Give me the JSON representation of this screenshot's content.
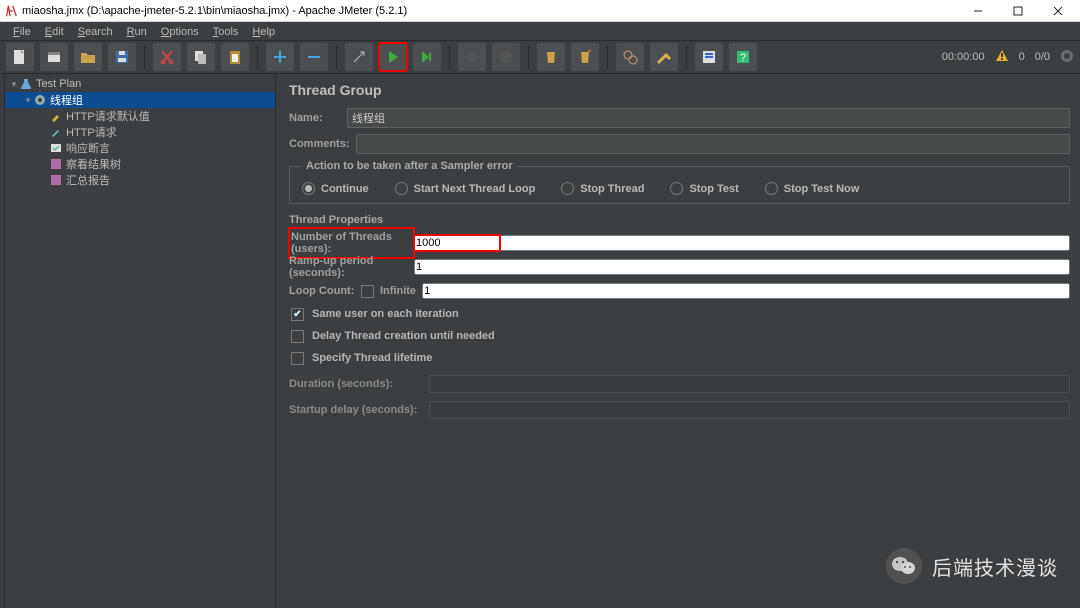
{
  "window": {
    "title": "miaosha.jmx (D:\\apache-jmeter-5.2.1\\bin\\miaosha.jmx) - Apache JMeter (5.2.1)"
  },
  "menu": {
    "file": "File",
    "edit": "Edit",
    "search": "Search",
    "run": "Run",
    "options": "Options",
    "tools": "Tools",
    "help": "Help"
  },
  "status": {
    "time": "00:00:00",
    "warn_count": "0",
    "active": "0/0"
  },
  "tree": {
    "test_plan": "Test Plan",
    "thread_group": "线程组",
    "http_defaults": "HTTP请求默认值",
    "http_request": "HTTP请求",
    "response_assert": "响应断言",
    "view_results": "察看结果树",
    "summary": "汇总报告"
  },
  "panel": {
    "title": "Thread Group",
    "labels": {
      "name": "Name:",
      "comments": "Comments:",
      "sampler_error_legend": "Action to be taken after a Sampler error",
      "continue": "Continue",
      "start_next": "Start Next Thread Loop",
      "stop_thread": "Stop Thread",
      "stop_test": "Stop Test",
      "stop_now": "Stop Test Now",
      "thread_props": "Thread Properties",
      "num_threads": "Number of Threads (users):",
      "ramp_up": "Ramp-up period (seconds):",
      "loop_count": "Loop Count:",
      "infinite": "Infinite",
      "same_user": "Same user on each iteration",
      "delay_create": "Delay Thread creation until needed",
      "specify_lifetime": "Specify Thread lifetime",
      "duration": "Duration (seconds):",
      "startup_delay": "Startup delay (seconds):"
    },
    "values": {
      "name": "线程组",
      "comments": "",
      "num_threads": "1000",
      "ramp_up": "1",
      "loop_count": "1",
      "same_user": true,
      "delay_create": false,
      "specify_lifetime": false,
      "infinite": false,
      "sampler_error": "continue"
    }
  },
  "watermark": "后端技术漫谈"
}
